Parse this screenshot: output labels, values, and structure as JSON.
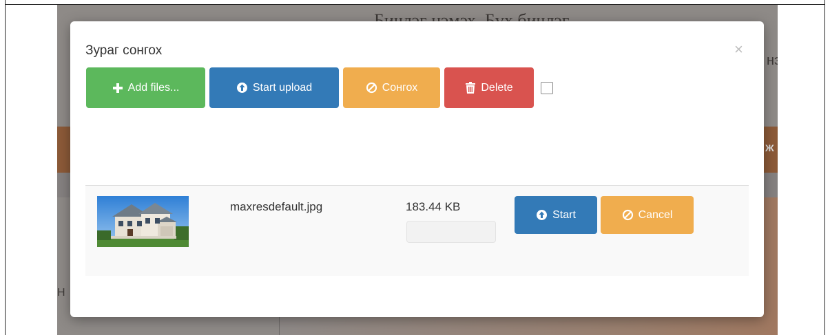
{
  "background": {
    "page_title": "Бичлэг нэмэх, Бүх бичлэг",
    "right_fragment": "нэ",
    "band_fragment": "Ж",
    "left_fragment": "Н"
  },
  "modal": {
    "title": "Зураг сонгох",
    "close_symbol": "×",
    "toolbar": {
      "add_files": "Add files...",
      "start_upload": "Start upload",
      "cancel_upload": "Сонгох",
      "delete": "Delete",
      "select_all_checked": false
    },
    "files": [
      {
        "name": "maxresdefault.jpg",
        "size": "183.44 KB",
        "progress_percent": 0,
        "start_label": "Start",
        "cancel_label": "Cancel"
      }
    ]
  },
  "colors": {
    "success": "#5cb85c",
    "primary": "#337ab7",
    "warning": "#f0ad4e",
    "danger": "#d9534f"
  },
  "icons": {
    "add_files": "plus-icon",
    "start_upload": "circle-arrow-up-icon",
    "cancel": "ban-icon",
    "delete": "trash-icon",
    "close": "close-icon"
  }
}
